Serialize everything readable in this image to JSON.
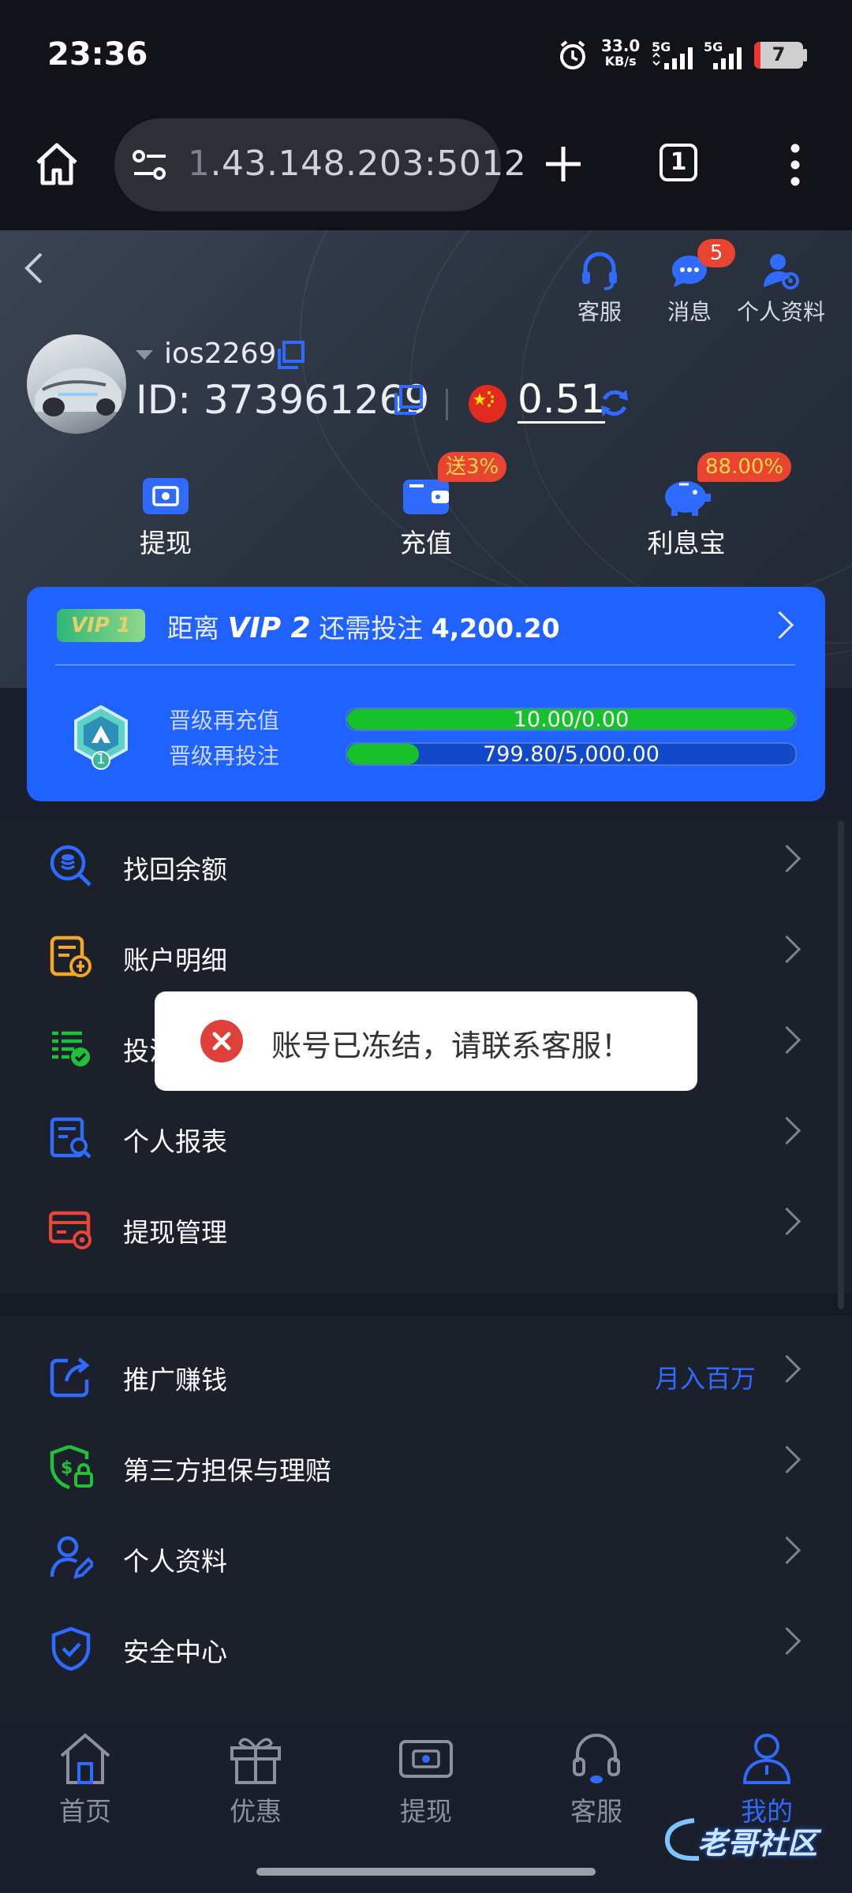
{
  "status_bar": {
    "time": "23:36",
    "net_speed_value": "33.0",
    "net_speed_unit": "KB/s",
    "sim1": "5G",
    "sim2": "5G",
    "battery": "7"
  },
  "browser": {
    "url_dim": "1",
    "url_main": ".43.148.203:5012",
    "tabs_count": "1"
  },
  "header": {
    "customer_service": "客服",
    "messages": "消息",
    "messages_badge": "5",
    "profile": "个人资料"
  },
  "user": {
    "username": "ios2269",
    "id_label": "ID: 373961269",
    "balance": "0.51"
  },
  "quick_actions": [
    {
      "label": "提现",
      "tag": ""
    },
    {
      "label": "充值",
      "tag": "送3%"
    },
    {
      "label": "利息宝",
      "tag": "88.00%"
    }
  ],
  "vip": {
    "level_badge": "VIP 1",
    "distance_text": "距离",
    "target_level": "VIP 2",
    "need_text": "还需投注",
    "need_amount": "4,200.20",
    "shield_level": "1",
    "recharge_label": "晋级再充值",
    "recharge_progress": "10.00/0.00",
    "recharge_fill": 1.0,
    "bet_label": "晋级再投注",
    "bet_progress": "799.80/5,000.00",
    "bet_fill": 0.16
  },
  "menu_primary": [
    {
      "label": "找回余额",
      "icon": "search-coin-icon"
    },
    {
      "label": "账户明细",
      "icon": "account-detail-icon"
    },
    {
      "label": "投注记录",
      "icon": "bet-record-icon"
    },
    {
      "label": "个人报表",
      "icon": "report-icon"
    },
    {
      "label": "提现管理",
      "icon": "withdraw-manage-icon"
    }
  ],
  "menu_secondary": [
    {
      "label": "推广赚钱",
      "icon": "share-icon",
      "extra": "月入百万"
    },
    {
      "label": "第三方担保与理赔",
      "icon": "shield-dollar-icon",
      "extra": ""
    },
    {
      "label": "个人资料",
      "icon": "user-edit-icon",
      "extra": ""
    },
    {
      "label": "安全中心",
      "icon": "shield-check-icon",
      "extra": ""
    }
  ],
  "toast": {
    "message": "账号已冻结，请联系客服！"
  },
  "bottom_nav": [
    {
      "label": "首页",
      "active": false
    },
    {
      "label": "优惠",
      "active": false
    },
    {
      "label": "提现",
      "active": false
    },
    {
      "label": "客服",
      "active": false
    },
    {
      "label": "我的",
      "active": true
    }
  ],
  "watermark": "老哥社区",
  "colors": {
    "accent": "#1f62ff",
    "progress_green": "#17c12b",
    "badge_red": "#e8442f",
    "toast_error": "#e0403a"
  }
}
